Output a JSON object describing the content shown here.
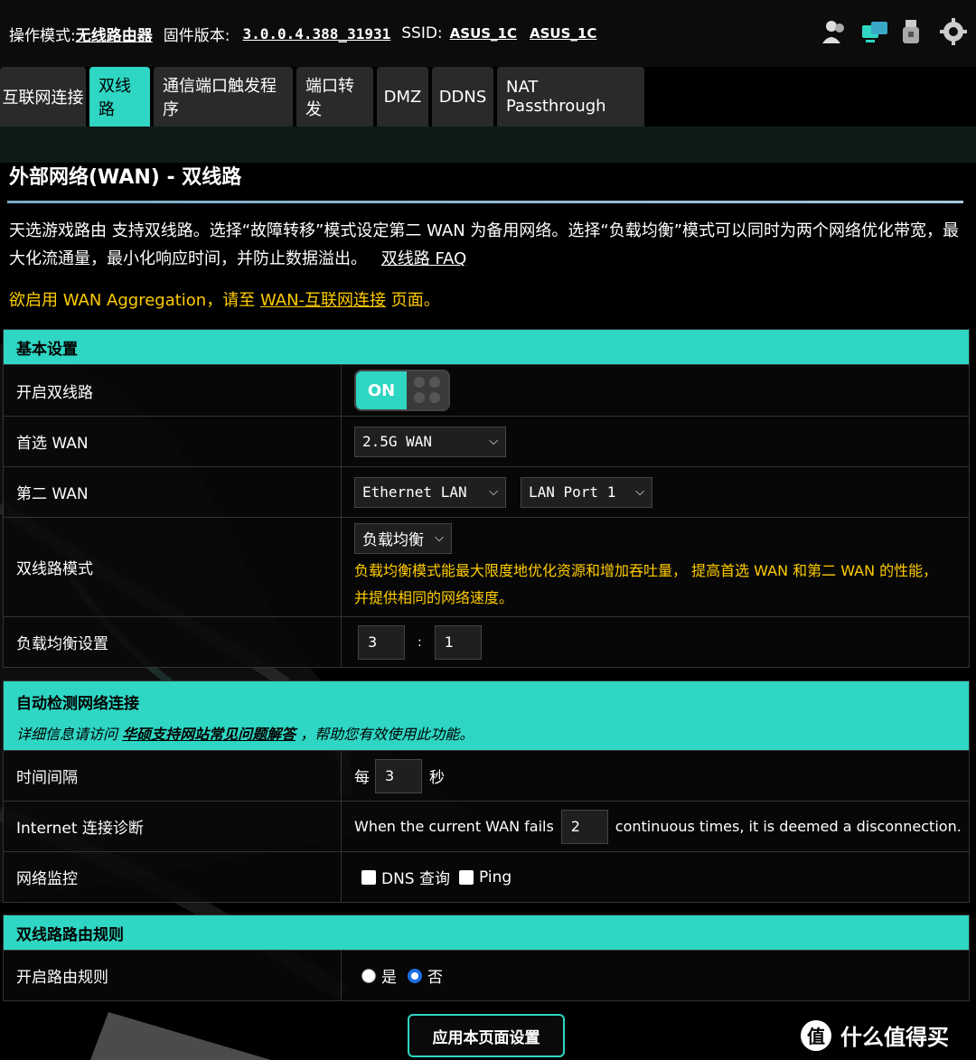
{
  "topbar": {
    "mode_label": "操作模式:",
    "mode_value": "无线路由器",
    "fw_label": "固件版本:",
    "fw_value": "3.0.0.4.388_31931",
    "ssid_label": "SSID:",
    "ssid_1": "ASUS_1C",
    "ssid_2": "ASUS_1C",
    "icons": [
      "users-icon",
      "network-status-icon",
      "usb-icon",
      "settings-gear-icon"
    ]
  },
  "tabs": [
    {
      "label": "互联网连接"
    },
    {
      "label": "双线路"
    },
    {
      "label": "通信端口触发程序"
    },
    {
      "label": "端口转发"
    },
    {
      "label": "DMZ"
    },
    {
      "label": "DDNS"
    },
    {
      "label": "NAT Passthrough"
    }
  ],
  "page": {
    "title": "外部网络(WAN) - 双线路",
    "intro": "天选游戏路由 支持双线路。选择“故障转移”模式设定第二 WAN 为备用网络。选择“负载均衡”模式可以同时为两个网络优化带宽，最大化流通量，最小化响应时间，并防止数据溢出。",
    "faq_link": "双线路 FAQ",
    "notice_prefix": "欲启用 WAN Aggregation，请至",
    "notice_link": "WAN-互联网连接",
    "notice_suffix": "页面。"
  },
  "basic": {
    "header": "基本设置",
    "enable_label": "开启双线路",
    "enable_toggle": "ON",
    "primary_label": "首选 WAN",
    "primary_value": "2.5G WAN",
    "secondary_label": "第二 WAN",
    "secondary_type": "Ethernet LAN",
    "secondary_port": "LAN Port 1",
    "mode_label": "双线路模式",
    "mode_value": "负载均衡",
    "mode_hint": "负载均衡模式能最大限度地优化资源和增加吞吐量， 提高首选 WAN 和第二 WAN 的性能，并提供相同的网络速度。",
    "ratio_label": "负载均衡设置",
    "ratio_a": "3",
    "ratio_sep": ":",
    "ratio_b": "1"
  },
  "detect": {
    "header": "自动检测网络连接",
    "sub_prefix": "详细信息请访问",
    "sub_link": "华硕支持网站常见问题解答",
    "sub_suffix": "，帮助您有效使用此功能。",
    "interval_label": "时间间隔",
    "interval_prefix": "每",
    "interval_value": "3",
    "interval_suffix": "秒",
    "diag_label": "Internet 连接诊断",
    "diag_prefix": "When the current WAN fails",
    "diag_value": "2",
    "diag_suffix": "continuous times, it is deemed a disconnection.",
    "monitor_label": "网络监控",
    "monitor_dns": "DNS 查询",
    "monitor_ping": "Ping"
  },
  "routing": {
    "header": "双线路路由规则",
    "enable_label": "开启路由规则",
    "yes": "是",
    "no": "否"
  },
  "apply_button": "应用本页面设置",
  "watermark": {
    "logo": "值",
    "text": "什么值得买"
  },
  "colors": {
    "accent": "#2ed6c3",
    "warning": "#ffcc00",
    "background": "#000000"
  }
}
